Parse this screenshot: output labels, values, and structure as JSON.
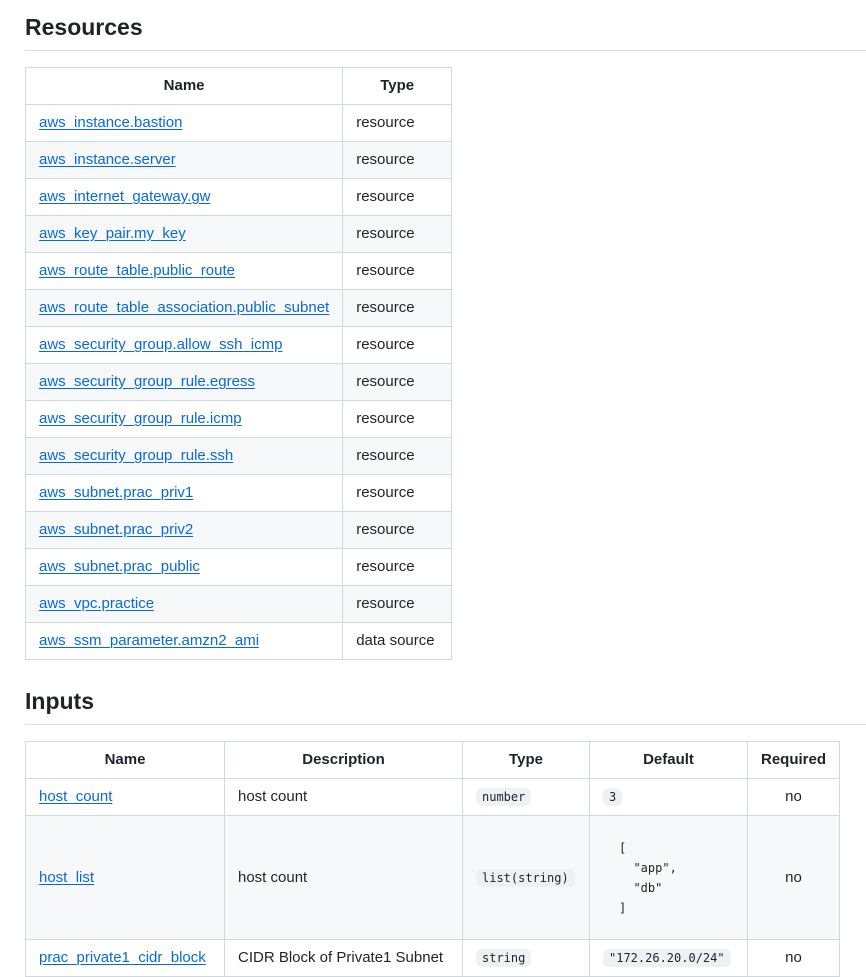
{
  "resources": {
    "heading": "Resources",
    "headers": [
      "Name",
      "Type"
    ],
    "rows": [
      {
        "name": "aws_instance.bastion",
        "type": "resource"
      },
      {
        "name": "aws_instance.server",
        "type": "resource"
      },
      {
        "name": "aws_internet_gateway.gw",
        "type": "resource"
      },
      {
        "name": "aws_key_pair.my_key",
        "type": "resource"
      },
      {
        "name": "aws_route_table.public_route",
        "type": "resource"
      },
      {
        "name": "aws_route_table_association.public_subnet",
        "type": "resource"
      },
      {
        "name": "aws_security_group.allow_ssh_icmp",
        "type": "resource"
      },
      {
        "name": "aws_security_group_rule.egress",
        "type": "resource"
      },
      {
        "name": "aws_security_group_rule.icmp",
        "type": "resource"
      },
      {
        "name": "aws_security_group_rule.ssh",
        "type": "resource"
      },
      {
        "name": "aws_subnet.prac_priv1",
        "type": "resource"
      },
      {
        "name": "aws_subnet.prac_priv2",
        "type": "resource"
      },
      {
        "name": "aws_subnet.prac_public",
        "type": "resource"
      },
      {
        "name": "aws_vpc.practice",
        "type": "resource"
      },
      {
        "name": "aws_ssm_parameter.amzn2_ami",
        "type": "data source"
      }
    ]
  },
  "inputs": {
    "heading": "Inputs",
    "headers": [
      "Name",
      "Description",
      "Type",
      "Default",
      "Required"
    ],
    "rows": [
      {
        "name": "host_count",
        "description": "host count",
        "type": "number",
        "default": "3",
        "required": "no"
      },
      {
        "name": "host_list",
        "description": "host count",
        "type": "list(string)",
        "default": "[\n  \"app\",\n  \"db\"\n]",
        "required": "no"
      },
      {
        "name": "prac_private1_cidr_block",
        "description": "CIDR Block of Private1 Subnet",
        "type": "string",
        "default": "\"172.26.20.0/24\"",
        "required": "no"
      }
    ]
  }
}
